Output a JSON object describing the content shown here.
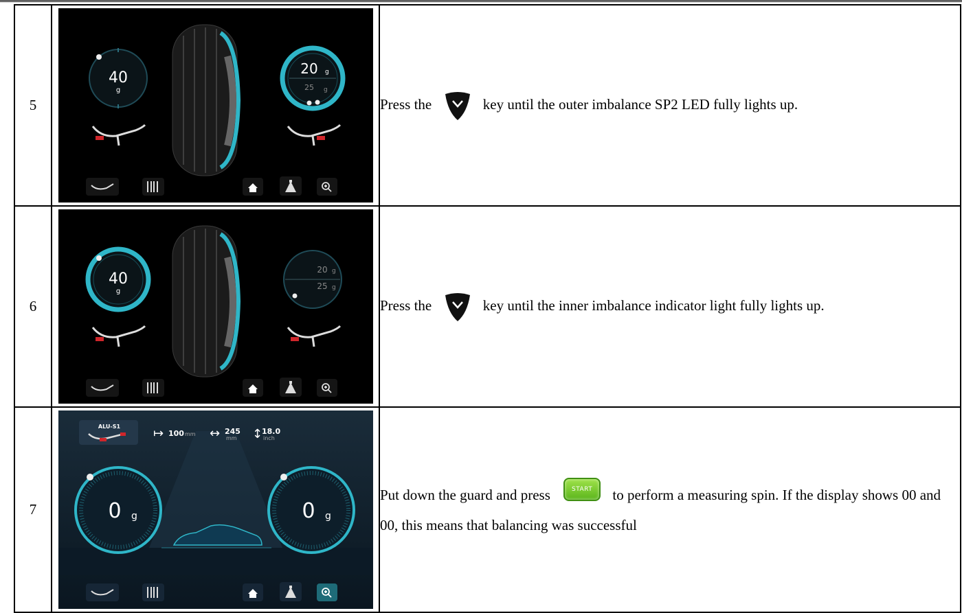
{
  "rows": [
    {
      "num": "5",
      "desc_before": "Press the",
      "key_icon": "chevron-down-key-icon",
      "desc_after": "key until the outer imbalance SP2 LED fully lights up.",
      "screen": {
        "left_value": "40",
        "left_unit": "g",
        "right_value": "20",
        "right_unit": "g",
        "right_sub_value": "25",
        "right_sub_unit": "g",
        "highlight": "right"
      }
    },
    {
      "num": "6",
      "desc_before": "Press the",
      "key_icon": "chevron-down-key-icon",
      "desc_after": "key until the inner imbalance indicator light fully lights up.",
      "screen": {
        "left_value": "40",
        "left_unit": "g",
        "right_value": "20",
        "right_unit": "g",
        "right_sub_value": "25",
        "right_sub_unit": "g",
        "highlight": "left"
      }
    },
    {
      "num": "7",
      "desc_before": "Put down the guard and press",
      "key_label": "START",
      "desc_after": "to perform a measuring spin. If the display shows 00 and 00, this means that balancing was successful",
      "screen": {
        "mode_label": "ALU-S1",
        "distance_value": "100",
        "distance_unit": "mm",
        "width_value": "245",
        "width_unit": "mm",
        "diameter_value": "18.0",
        "diameter_unit": "inch",
        "left_value": "0",
        "left_unit": "g",
        "right_value": "0",
        "right_unit": "g"
      }
    }
  ],
  "colors": {
    "ring_glow": "#2fb6c8",
    "ring_dim": "#1c4a55",
    "weight_red": "#d0262b",
    "screen_bg_dark": "#000000",
    "screen_bg_blue": "#0e2233",
    "start_green": "#6fc626"
  },
  "toolbar_icons": [
    "wheel-type-icon",
    "barcode-icon",
    "home-icon",
    "weight-split-icon",
    "zoom-icon"
  ]
}
